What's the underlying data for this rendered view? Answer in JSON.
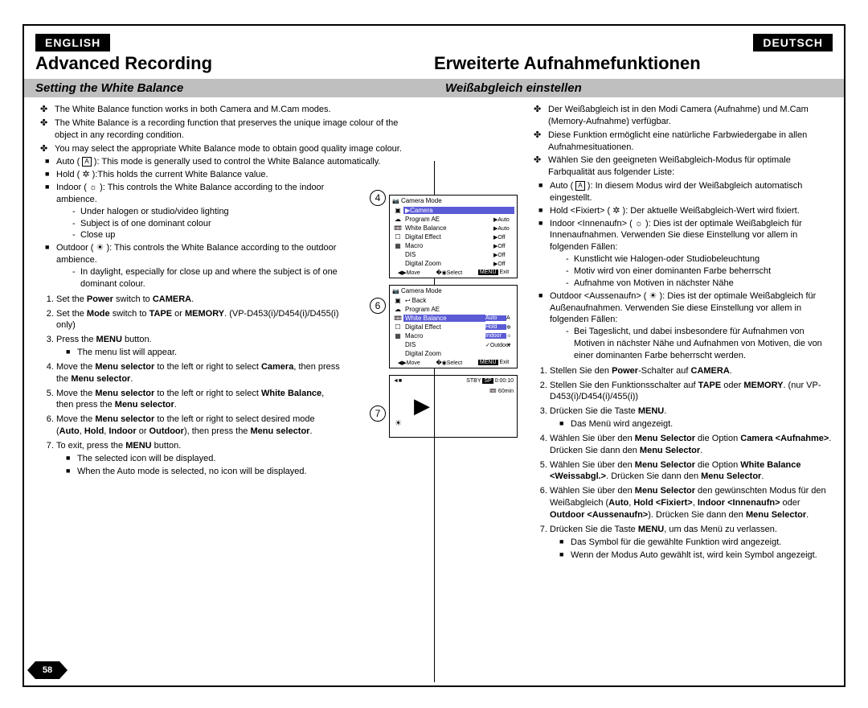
{
  "page_number": "58",
  "lang_left": "ENGLISH",
  "lang_right": "DEUTSCH",
  "heading_left": "Advanced Recording",
  "heading_right": "Erweiterte Aufnahmefunktionen",
  "sub_left": "Setting the White Balance",
  "sub_right": "Weißabgleich einstellen",
  "en": {
    "b1": "The White Balance function works in both Camera and M.Cam modes.",
    "b2": "The White Balance is a recording function that preserves the unique image colour of the object in any recording condition.",
    "b3": "You may select the appropriate White Balance mode to obtain good quality image colour.",
    "mA1": "Auto ( ",
    "mA2": " ): This mode is generally used to control the White Balance automatically.",
    "mH": "Hold ( ",
    "mH2": " ):This holds the current White Balance value.",
    "mI": "Indoor ( ",
    "mI2": " ): This controls the White Balance according to the indoor ambience.",
    "mI_d1": "Under halogen or studio/video lighting",
    "mI_d2": "Subject is of one dominant colour",
    "mI_d3": "Close up",
    "mO": "Outdoor ( ",
    "mO2": " ): This controls the White Balance according to the outdoor ambience.",
    "mO_d1": "In daylight, especially for close up and where the subject is of one dominant colour.",
    "s1a": "Set the ",
    "s1b": "Power",
    "s1c": " switch to ",
    "s1d": "CAMERA",
    "s1e": ".",
    "s2a": "Set the ",
    "s2b": "Mode",
    "s2c": " switch to ",
    "s2d": "TAPE",
    "s2e": " or ",
    "s2f": "MEMORY",
    "s2g": ". (VP-D453(i)/D454(i)/D455(i) only)",
    "s3a": "Press the ",
    "s3b": "MENU",
    "s3c": " button.",
    "s3n": "The menu list will appear.",
    "s4a": "Move the ",
    "s4b": "Menu selector",
    "s4c": " to the left or right to select ",
    "s4d": "Camera",
    "s4e": ", then press the ",
    "s4f": "Menu selector",
    "s5a": "Move the ",
    "s5d": "White Balance",
    "s6a": "Move the ",
    "s6c": " to the left or right to select desired mode (",
    "s6d": "Auto",
    "s6d2": ", ",
    "s6e": "Hold",
    "s6e2": ", ",
    "s6f": "Indoor",
    "s6f2": " or ",
    "s6g": "Outdoor",
    "s6g2": "), then press the ",
    "s7a": "To exit, press the ",
    "s7b": "MENU",
    "s7c": " button.",
    "s7n1": "The selected icon will be displayed.",
    "s7n2": "When the Auto mode is selected, no icon will be displayed."
  },
  "de": {
    "b1": "Der Weißabgleich ist in den Modi Camera (Aufnahme) und M.Cam (Memory-Aufnahme) verfügbar.",
    "b2": "Diese Funktion ermöglicht eine natürliche Farbwiedergabe in allen Aufnahmesituationen.",
    "b3": "Wählen Sie den geeigneten Weißabgleich-Modus für optimale Farbqualität aus folgender Liste:",
    "mA": "Auto ( ",
    "mA2": " ): In diesem Modus wird der Weißabgleich automatisch eingestellt.",
    "mH": "Hold <Fixiert> ( ",
    "mH2": " ): Der aktuelle Weißabgleich-Wert wird fixiert.",
    "mI": "Indoor <Innenaufn> ( ",
    "mI2": " ): Dies ist der optimale Weißabgleich für Innenaufnahmen. Verwenden Sie diese Einstellung vor allem in folgenden Fällen:",
    "mI_d1": "Kunstlicht wie Halogen-oder Studiobeleuchtung",
    "mI_d2": "Motiv wird von einer dominanten Farbe beherrscht",
    "mI_d3": "Aufnahme von Motiven in nächster Nähe",
    "mO": "Outdoor <Aussenaufn> ( ",
    "mO2": " ): Dies ist der optimale Weißabgleich für Außenaufnahmen. Verwenden Sie diese Einstellung vor allem in folgenden Fällen:",
    "mO_d1": "Bei Tageslicht, und dabei insbesondere für Aufnahmen von Motiven in nächster Nähe und Aufnahmen von Motiven, die von einer dominanten Farbe beherrscht werden.",
    "s1a": "Stellen Sie den ",
    "s1b": "Power",
    "s1c": "-Schalter auf ",
    "s1d": "CAMERA",
    "s1e": ".",
    "s2a": "Stellen Sie den Funktionsschalter auf ",
    "s2b": "TAPE",
    "s2c": " oder ",
    "s2d": "MEMORY",
    "s2e": ". (nur VP-D453(i)/D454(i)/455(i))",
    "s3a": "Drücken Sie die Taste ",
    "s3b": "MENU",
    "s3c": ".",
    "s3n": "Das Menü wird angezeigt.",
    "s4a": "Wählen Sie über den ",
    "s4b": "Menu Selector",
    "s4c": " die Option ",
    "s4d": "Camera <Aufnahme>",
    "s4e": ". Drücken Sie dann den ",
    "s5d": "White Balance <Weissabgl.>",
    "s6a": "Wählen Sie über den ",
    "s6c": " den gewünschten Modus für den Weißabgleich (",
    "s6d": "Auto",
    "s6e": "Hold <Fixiert>",
    "s6f": "Indoor <Innenaufn>",
    "s6g": "Outdoor <Aussenaufn>",
    "s6g2": "). Drücken Sie dann den ",
    "s7a": "Drücken Sie die Taste ",
    "s7b": "MENU",
    "s7c": ", um das Menü zu verlassen.",
    "s7n1": "Das Symbol für die gewählte Funktion wird angezeigt.",
    "s7n2": "Wenn der Modus Auto gewählt ist, wird kein Symbol angezeigt."
  },
  "figs": {
    "c4": "4",
    "c6": "6",
    "c7": "7",
    "title": "Camera Mode",
    "camera": "▶Camera",
    "back": "Back",
    "rows": [
      "Program AE",
      "White Balance",
      "Digital Effect",
      "Macro",
      "DIS",
      "Digital Zoom"
    ],
    "vals4": [
      "▶Auto",
      "▶Auto",
      "▶Off",
      "▶Off",
      "▶Off",
      "▶Off"
    ],
    "opts6": [
      "Auto",
      "Hold",
      "Indoor",
      "✓Outdoor"
    ],
    "foot_move": "Move",
    "foot_select": "Select",
    "foot_exit": "Exit",
    "menu_btn": "MENU",
    "stby": "STBY",
    "sp": "SP",
    "time": "0:00:10",
    "batt": "60min"
  },
  "icons": {
    "A": "A",
    "gear": "✲",
    "bulb": "☼",
    "sun": "☀"
  }
}
